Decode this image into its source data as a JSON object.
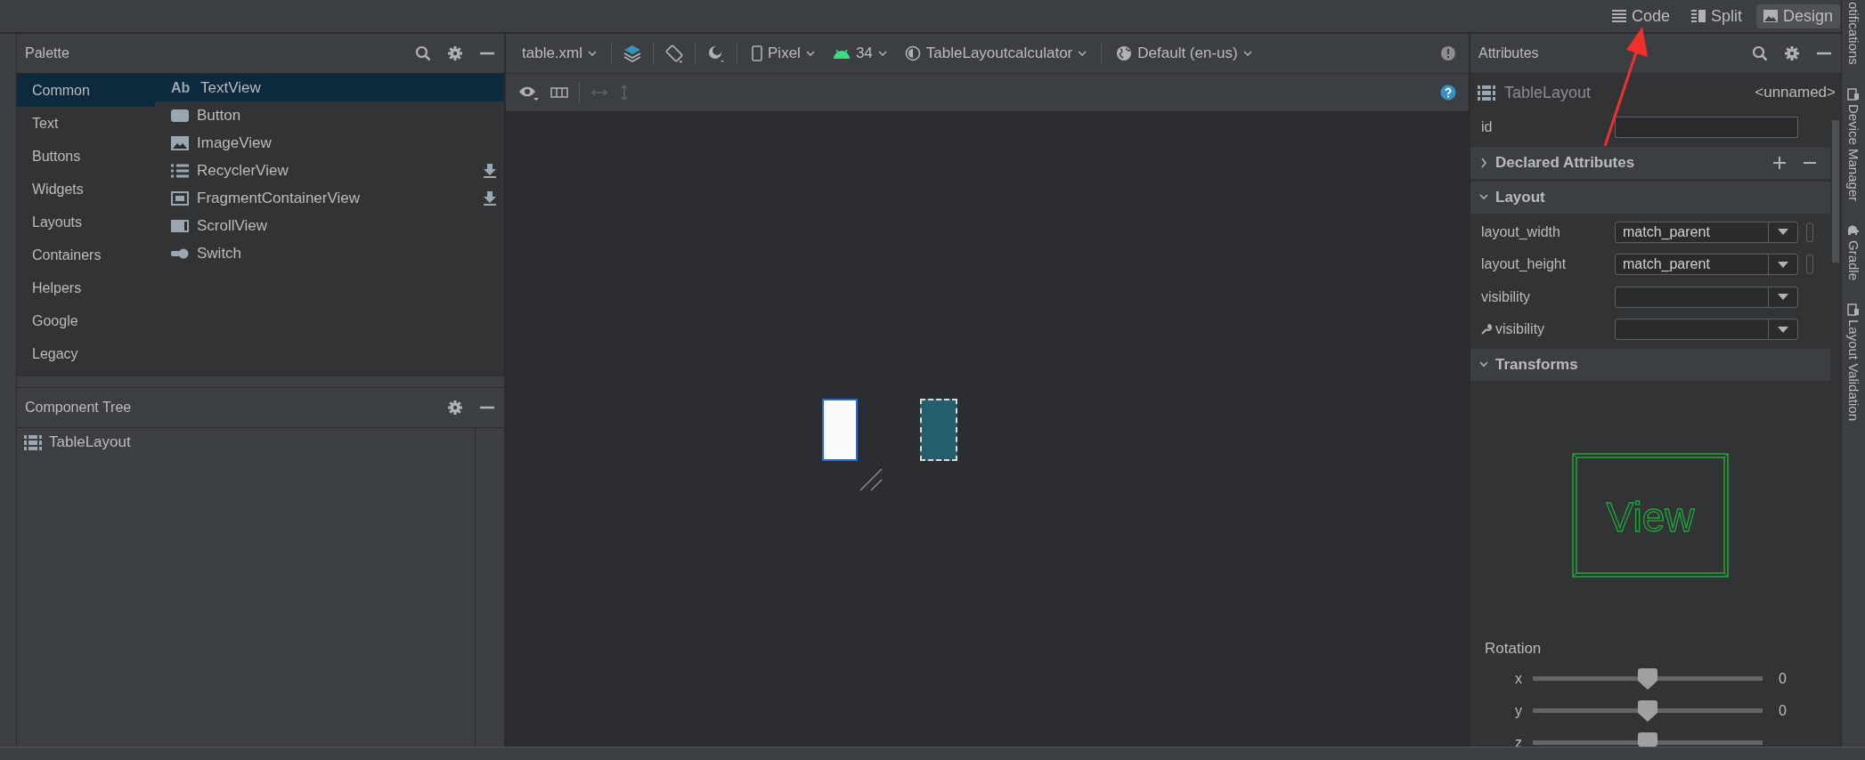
{
  "view_modes": [
    {
      "label": "Code",
      "kind": "code",
      "selected": false
    },
    {
      "label": "Split",
      "kind": "split",
      "selected": false
    },
    {
      "label": "Design",
      "kind": "design",
      "selected": true
    }
  ],
  "palette": {
    "title": "Palette",
    "categories": [
      {
        "label": "Common",
        "selected": true
      },
      {
        "label": "Text",
        "selected": false
      },
      {
        "label": "Buttons",
        "selected": false
      },
      {
        "label": "Widgets",
        "selected": false
      },
      {
        "label": "Layouts",
        "selected": false
      },
      {
        "label": "Containers",
        "selected": false
      },
      {
        "label": "Helpers",
        "selected": false
      },
      {
        "label": "Google",
        "selected": false
      },
      {
        "label": "Legacy",
        "selected": false
      }
    ],
    "items": [
      {
        "label": "TextView",
        "kind": "text",
        "icon_text": "Ab",
        "selected": true,
        "download": false
      },
      {
        "label": "Button",
        "kind": "button",
        "selected": false,
        "download": false
      },
      {
        "label": "ImageView",
        "kind": "image",
        "selected": false,
        "download": false
      },
      {
        "label": "RecyclerView",
        "kind": "list",
        "selected": false,
        "download": true
      },
      {
        "label": "FragmentContainerView",
        "kind": "fragment",
        "selected": false,
        "download": true
      },
      {
        "label": "ScrollView",
        "kind": "scroll",
        "selected": false,
        "download": false
      },
      {
        "label": "Switch",
        "kind": "switch",
        "selected": false,
        "download": false
      }
    ]
  },
  "component_tree": {
    "title": "Component Tree",
    "items": [
      {
        "label": "TableLayout"
      }
    ]
  },
  "toolbar": {
    "file": "table.xml",
    "device": "Pixel",
    "api": "34",
    "theme": "TableLayoutcalculator",
    "locale": "Default (en-us)"
  },
  "attributes": {
    "title": "Attributes",
    "component": "TableLayout",
    "name": "<unnamed>",
    "id_label": "id",
    "sections": [
      {
        "title": "Declared Attributes",
        "kind": "declared",
        "expanded": false
      },
      {
        "title": "Layout",
        "kind": "layout",
        "expanded": true,
        "rows": [
          {
            "label": "layout_width",
            "value": "match_parent",
            "picker": true,
            "wrench": false
          },
          {
            "label": "layout_height",
            "value": "match_parent",
            "picker": true,
            "wrench": false
          },
          {
            "label": "visibility",
            "picker": false,
            "wrench": false
          },
          {
            "label": "visibility",
            "picker": false,
            "wrench": true
          }
        ]
      },
      {
        "title": "Transforms",
        "kind": "transforms",
        "expanded": true,
        "preview": "View",
        "rotation": "Rotation",
        "sliders": [
          {
            "axis": "x",
            "level": 0.5,
            "reading": "0"
          },
          {
            "axis": "y",
            "level": 0.5,
            "reading": "0"
          },
          {
            "axis": "z",
            "level": 0.5
          }
        ]
      }
    ]
  },
  "side_tabs": [
    {
      "label": "otifications",
      "kind": "plain"
    },
    {
      "label": "Device Manager",
      "kind": "device"
    },
    {
      "label": "Gradle",
      "kind": "elephant"
    },
    {
      "label": "Layout Validation",
      "kind": "device"
    }
  ]
}
